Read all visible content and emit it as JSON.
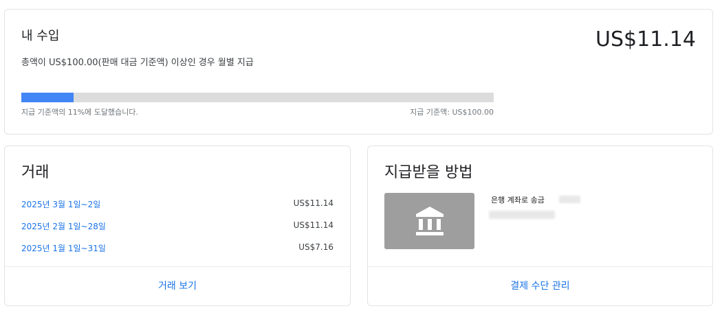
{
  "earnings": {
    "title": "내 수입",
    "description": "총액이 US$100.00(판매 대금 기준액) 이상인 경우 월별 지급",
    "amount": "US$11.14",
    "progress_percent": 11,
    "progress_text": "지급 기준액의 11%에 도달했습니다.",
    "threshold_text": "지급 기준액: US$100.00"
  },
  "transactions": {
    "title": "거래",
    "rows": [
      {
        "period": "2025년 3월 1일~2일",
        "amount": "US$11.14"
      },
      {
        "period": "2025년 2월 1일~28일",
        "amount": "US$11.14"
      },
      {
        "period": "2025년 1월 1일~31일",
        "amount": "US$7.16"
      }
    ],
    "footer_link": "거래 보기"
  },
  "payment": {
    "title": "지급받을 방법",
    "method_label": "은행 계좌로 송금",
    "footer_link": "결제 수단 관리",
    "icon": "bank-icon"
  },
  "colors": {
    "accent": "#1a73e8",
    "progress": "#4285f4",
    "track": "#dcdcdc",
    "bank_bg": "#9e9e9e"
  }
}
